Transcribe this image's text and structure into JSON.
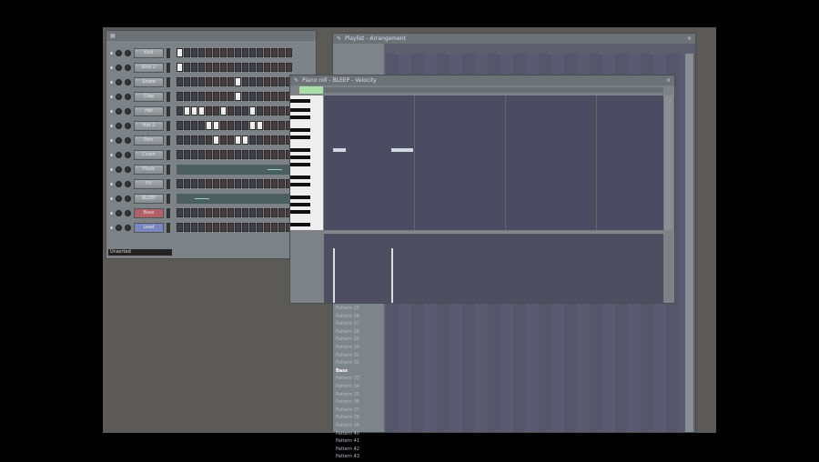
{
  "channel_rack": {
    "preset_label": "Unsorted",
    "channels": [
      {
        "name": "Kick",
        "steps": [
          0
        ]
      },
      {
        "name": "Kick 2",
        "steps": [
          0
        ]
      },
      {
        "name": "Snare",
        "steps": [
          8
        ]
      },
      {
        "name": "Clap",
        "steps": [
          8
        ]
      },
      {
        "name": "Hat",
        "steps": [
          1,
          2,
          3,
          6,
          10
        ]
      },
      {
        "name": "Hat 2",
        "steps": [
          4,
          5,
          10,
          11
        ]
      },
      {
        "name": "Perc",
        "steps": [
          5,
          8,
          9
        ]
      },
      {
        "name": "Crash",
        "steps": []
      },
      {
        "name": "Pluck",
        "type": "graph",
        "steps": []
      },
      {
        "name": "FX",
        "steps": []
      },
      {
        "name": "BLEEP",
        "type": "graph",
        "steps": []
      },
      {
        "name": "Bass",
        "steps": [],
        "color": "#b06068"
      },
      {
        "name": "Lead",
        "steps": [],
        "color": "#7a86c0"
      }
    ]
  },
  "playlist": {
    "title": "Playlist - Arrangement",
    "patterns": [
      "Pattern 25",
      "Pattern 26",
      "Pattern 27",
      "Pattern 28",
      "Pattern 29",
      "Pattern 30",
      "Pattern 31",
      "Pattern 32"
    ],
    "section": "Bass",
    "patterns2": [
      "Pattern 33",
      "Pattern 34",
      "Pattern 35",
      "Pattern 36",
      "Pattern 37",
      "Pattern 38",
      "Pattern 39",
      "Pattern 40",
      "Pattern 41",
      "Pattern 42",
      "Pattern 43"
    ]
  },
  "piano_roll": {
    "title": "Piano roll - BLEEP - Velocity"
  },
  "colors": {
    "accent": "#a8e0a8"
  }
}
